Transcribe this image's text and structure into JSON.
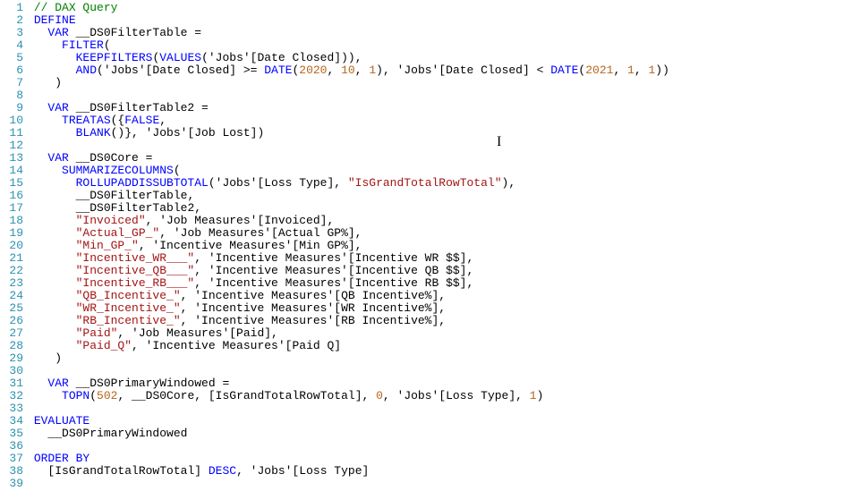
{
  "lines": {
    "n1": "1",
    "n2": "2",
    "n3": "3",
    "n4": "4",
    "n5": "5",
    "n6": "6",
    "n7": "7",
    "n8": "8",
    "n9": "9",
    "n10": "10",
    "n11": "11",
    "n12": "12",
    "n13": "13",
    "n14": "14",
    "n15": "15",
    "n16": "16",
    "n17": "17",
    "n18": "18",
    "n19": "19",
    "n20": "20",
    "n21": "21",
    "n22": "22",
    "n23": "23",
    "n24": "24",
    "n25": "25",
    "n26": "26",
    "n27": "27",
    "n28": "28",
    "n29": "29",
    "n30": "30",
    "n31": "31",
    "n32": "32",
    "n33": "33",
    "n34": "34",
    "n35": "35",
    "n36": "36",
    "n37": "37",
    "n38": "38",
    "n39": "39"
  },
  "t": {
    "comment": "// DAX Query",
    "DEFINE": "DEFINE",
    "VAR": "VAR",
    "v1": " __DS0FilterTable =",
    "FILTER": "FILTER",
    "lparen": "(",
    "KEEPFILTERS": "KEEPFILTERS",
    "VALUES": "VALUES",
    "jobsDateClosed": "('Jobs'[Date Closed])),",
    "AND": "AND",
    "andBody1": "('Jobs'[Date Closed] >= ",
    "DATE": "DATE",
    "d2020": "2020",
    "ten": "10",
    "one": "1",
    "andBody2": "), 'Jobs'[Date Closed] < ",
    "d2021": "2021",
    "andBody3": "))",
    "rparen": "    )",
    "v2": " __DS0FilterTable2 =",
    "TREATAS": "TREATAS",
    "treatasBody1": "({",
    "FALSE": "FALSE",
    "comma": ",",
    "BLANK": "BLANK",
    "treatasBody2": "()}, 'Jobs'[Job Lost])",
    "v3": " __DS0Core =",
    "SUMMARIZECOLUMNS": "SUMMARIZECOLUMNS",
    "ROLLUPADDISSUBTOTAL": "ROLLUPADDISSUBTOTAL",
    "rollBody1": "('Jobs'[Loss Type], ",
    "isGrand": "\"IsGrandTotalRowTotal\"",
    "rollBody2": "),",
    "ft": "      __DS0FilterTable,",
    "ft2": "      __DS0FilterTable2,",
    "sInvoiced": "\"Invoiced\"",
    "invoicedRest": ", 'Job Measures'[Invoiced],",
    "sActualGP": "\"Actual_GP_\"",
    "actualGPRest": ", 'Job Measures'[Actual GP%],",
    "sMinGP": "\"Min_GP_\"",
    "minGPRest": ", 'Incentive Measures'[Min GP%],",
    "sIncWR": "\"Incentive_WR___\"",
    "incWRRest": ", 'Incentive Measures'[Incentive WR $$],",
    "sIncQB": "\"Incentive_QB___\"",
    "incQBRest": ", 'Incentive Measures'[Incentive QB $$],",
    "sIncRB": "\"Incentive_RB___\"",
    "incRBRest": ", 'Incentive Measures'[Incentive RB $$],",
    "sQBInc": "\"QB_Incentive_\"",
    "qbIncRest": ", 'Incentive Measures'[QB Incentive%],",
    "sWRInc": "\"WR_Incentive_\"",
    "wrIncRest": ", 'Incentive Measures'[WR Incentive%],",
    "sRBInc": "\"RB_Incentive_\"",
    "rbIncRest": ", 'Incentive Measures'[RB Incentive%],",
    "sPaid": "\"Paid\"",
    "paidRest": ", 'Job Measures'[Paid],",
    "sPaidQ": "\"Paid_Q\"",
    "paidQRest": ", 'Incentive Measures'[Paid Q]",
    "v4": " __DS0PrimaryWindowed =",
    "TOPN": "TOPN",
    "n502": "502",
    "topnBody1": ", __DS0Core, [IsGrandTotalRowTotal], ",
    "zero": "0",
    "topnBody2": ", 'Jobs'[Loss Type], ",
    "topnBody3": ")",
    "EVALUATE": "EVALUATE",
    "evalBody": "  __DS0PrimaryWindowed",
    "ORDERBY": "ORDER BY",
    "orderBody1": "  [IsGrandTotalRowTotal] ",
    "DESC": "DESC",
    "orderBody2": ", 'Jobs'[Loss Type]",
    "pad4": "    ",
    "pad6": "      ",
    "topnOpen": "(",
    "dArgs1": "(",
    "dSep": ", ",
    "dClose": ")"
  }
}
